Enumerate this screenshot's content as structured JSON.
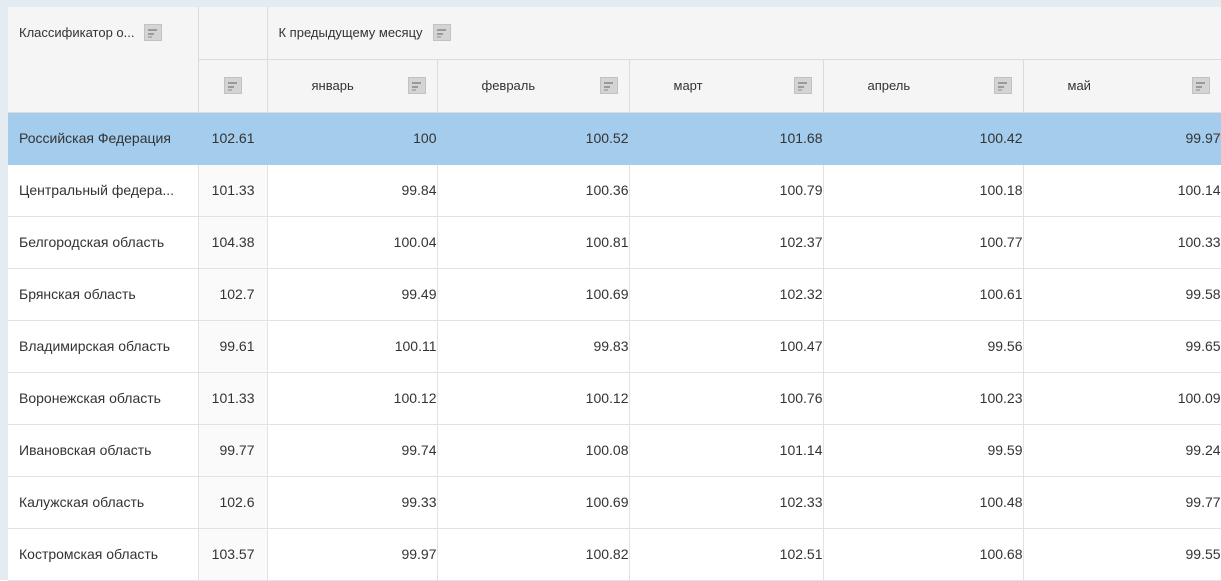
{
  "header": {
    "classifier_label": "Классификатор о...",
    "group_label": "К предыдущему месяцу",
    "months": [
      "январь",
      "февраль",
      "март",
      "апрель",
      "май"
    ]
  },
  "rows": [
    {
      "name": "Российская Федерация",
      "total": "102.61",
      "values": [
        "100",
        "100.52",
        "101.68",
        "100.42",
        "99.97"
      ]
    },
    {
      "name": "Центральный федера...",
      "total": "101.33",
      "values": [
        "99.84",
        "100.36",
        "100.79",
        "100.18",
        "100.14"
      ]
    },
    {
      "name": "Белгородская область",
      "total": "104.38",
      "values": [
        "100.04",
        "100.81",
        "102.37",
        "100.77",
        "100.33"
      ]
    },
    {
      "name": "Брянская область",
      "total": "102.7",
      "values": [
        "99.49",
        "100.69",
        "102.32",
        "100.61",
        "99.58"
      ]
    },
    {
      "name": "Владимирская область",
      "total": "99.61",
      "values": [
        "100.11",
        "99.83",
        "100.47",
        "99.56",
        "99.65"
      ]
    },
    {
      "name": "Воронежская область",
      "total": "101.33",
      "values": [
        "100.12",
        "100.12",
        "100.76",
        "100.23",
        "100.09"
      ]
    },
    {
      "name": "Ивановская область",
      "total": "99.77",
      "values": [
        "99.74",
        "100.08",
        "101.14",
        "99.59",
        "99.24"
      ]
    },
    {
      "name": "Калужская область",
      "total": "102.6",
      "values": [
        "99.33",
        "100.69",
        "102.33",
        "100.48",
        "99.77"
      ]
    },
    {
      "name": "Костромская область",
      "total": "103.57",
      "values": [
        "99.97",
        "100.82",
        "102.51",
        "100.68",
        "99.55"
      ]
    }
  ],
  "selected_row": 0,
  "colors": {
    "selected_row": "#a3cced",
    "header_bg": "#f5f5f5",
    "frame": "#e4ecf2"
  }
}
